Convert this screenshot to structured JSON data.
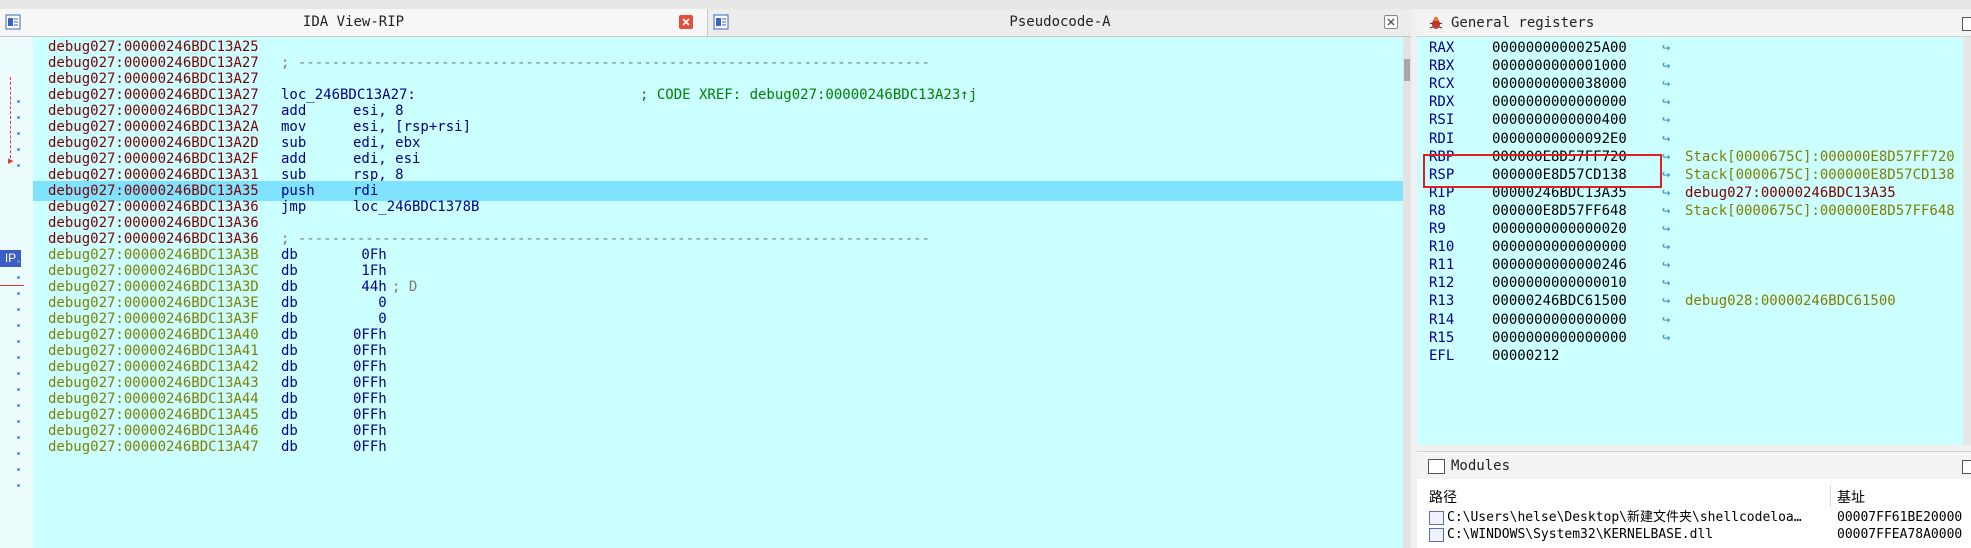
{
  "ida_view": {
    "title": "IDA View-RIP",
    "ip_label": "IP",
    "rows": [
      {
        "addr": "debug027:00000246BDC13A25",
        "kind": "code"
      },
      {
        "addr": "debug027:00000246BDC13A27",
        "kind": "code",
        "sep": "; ---------------------------------------------------------------------------"
      },
      {
        "addr": "debug027:00000246BDC13A27",
        "kind": "code"
      },
      {
        "addr": "debug027:00000246BDC13A27",
        "kind": "code",
        "label": "loc_246BDC13A27:",
        "comment": "; CODE XREF: debug027:00000246BDC13A23↑j"
      },
      {
        "addr": "debug027:00000246BDC13A27",
        "kind": "code",
        "mnem": "add",
        "ops": "esi, 8"
      },
      {
        "addr": "debug027:00000246BDC13A2A",
        "kind": "code",
        "mnem": "mov",
        "ops": "esi, [rsp+rsi]"
      },
      {
        "addr": "debug027:00000246BDC13A2D",
        "kind": "code",
        "mnem": "sub",
        "ops": "edi, ebx"
      },
      {
        "addr": "debug027:00000246BDC13A2F",
        "kind": "code",
        "mnem": "add",
        "ops": "edi, esi"
      },
      {
        "addr": "debug027:00000246BDC13A31",
        "kind": "code",
        "mnem": "sub",
        "ops": "rsp, 8"
      },
      {
        "addr": "debug027:00000246BDC13A35",
        "kind": "code",
        "mnem": "push",
        "ops": "rdi",
        "highlight": true
      },
      {
        "addr": "debug027:00000246BDC13A36",
        "kind": "code",
        "mnem": "jmp",
        "ops": "loc_246BDC1378B"
      },
      {
        "addr": "debug027:00000246BDC13A36",
        "kind": "code"
      },
      {
        "addr": "debug027:00000246BDC13A36",
        "kind": "code",
        "sep": "; ---------------------------------------------------------------------------"
      },
      {
        "addr": "debug027:00000246BDC13A3B",
        "kind": "data",
        "mnem": "db",
        "num": " 0Fh"
      },
      {
        "addr": "debug027:00000246BDC13A3C",
        "kind": "data",
        "mnem": "db",
        "num": " 1Fh"
      },
      {
        "addr": "debug027:00000246BDC13A3D",
        "kind": "data",
        "mnem": "db",
        "num": " 44h",
        "comment2": "; D"
      },
      {
        "addr": "debug027:00000246BDC13A3E",
        "kind": "data",
        "mnem": "db",
        "num": "   0"
      },
      {
        "addr": "debug027:00000246BDC13A3F",
        "kind": "data",
        "mnem": "db",
        "num": "   0"
      },
      {
        "addr": "debug027:00000246BDC13A40",
        "kind": "data",
        "mnem": "db",
        "num": "0FFh"
      },
      {
        "addr": "debug027:00000246BDC13A41",
        "kind": "data",
        "mnem": "db",
        "num": "0FFh"
      },
      {
        "addr": "debug027:00000246BDC13A42",
        "kind": "data",
        "mnem": "db",
        "num": "0FFh"
      },
      {
        "addr": "debug027:00000246BDC13A43",
        "kind": "data",
        "mnem": "db",
        "num": "0FFh"
      },
      {
        "addr": "debug027:00000246BDC13A44",
        "kind": "data",
        "mnem": "db",
        "num": "0FFh"
      },
      {
        "addr": "debug027:00000246BDC13A45",
        "kind": "data",
        "mnem": "db",
        "num": "0FFh"
      },
      {
        "addr": "debug027:00000246BDC13A46",
        "kind": "data",
        "mnem": "db",
        "num": "0FFh"
      },
      {
        "addr": "debug027:00000246BDC13A47",
        "kind": "data",
        "mnem": "db",
        "num": "0FFh"
      }
    ]
  },
  "pseudocode": {
    "title": "Pseudocode-A"
  },
  "registers": {
    "title": "General registers",
    "rows": [
      {
        "name": "RAX",
        "value": "0000000000025A00"
      },
      {
        "name": "RBX",
        "value": "0000000000001000"
      },
      {
        "name": "RCX",
        "value": "0000000000038000"
      },
      {
        "name": "RDX",
        "value": "0000000000000000"
      },
      {
        "name": "RSI",
        "value": "0000000000000400"
      },
      {
        "name": "RDI",
        "value": "00000000000092E0"
      },
      {
        "name": "RBP",
        "value": "000000E8D57FF720",
        "target": "Stack[0000675C]:000000E8D57FF720",
        "ttype": "stack"
      },
      {
        "name": "RSP",
        "value": "000000E8D57CD138",
        "target": "Stack[0000675C]:000000E8D57CD138",
        "ttype": "stack"
      },
      {
        "name": "RIP",
        "value": "00000246BDC13A35",
        "target": "debug027:00000246BDC13A35",
        "ttype": "code"
      },
      {
        "name": "R8",
        "value": "000000E8D57FF648",
        "target": "Stack[0000675C]:000000E8D57FF648",
        "ttype": "stack"
      },
      {
        "name": "R9",
        "value": "0000000000000020"
      },
      {
        "name": "R10",
        "value": "0000000000000000"
      },
      {
        "name": "R11",
        "value": "0000000000000246"
      },
      {
        "name": "R12",
        "value": "0000000000000010"
      },
      {
        "name": "R13",
        "value": "00000246BDC61500",
        "target": "debug028:00000246BDC61500",
        "ttype": "data"
      },
      {
        "name": "R14",
        "value": "0000000000000000"
      },
      {
        "name": "R15",
        "value": "0000000000000000"
      },
      {
        "name": "EFL",
        "value": "00000212"
      }
    ]
  },
  "modules": {
    "title": "Modules",
    "col_path": "路径",
    "col_base": "基址",
    "rows": [
      {
        "path": "C:\\Users\\helse\\Desktop\\新建文件夹\\shellcodeloa…",
        "base": "00007FF61BE20000"
      },
      {
        "path": "C:\\WINDOWS\\System32\\KERNELBASE.dll",
        "base": "00007FFEA78A0000"
      }
    ]
  },
  "colors": {
    "listing_bg": "#ccffff",
    "highlight_row": "#7fe3ff",
    "address_code": "#800000",
    "address_data": "#808000",
    "selection_box": "#e01f1f"
  }
}
